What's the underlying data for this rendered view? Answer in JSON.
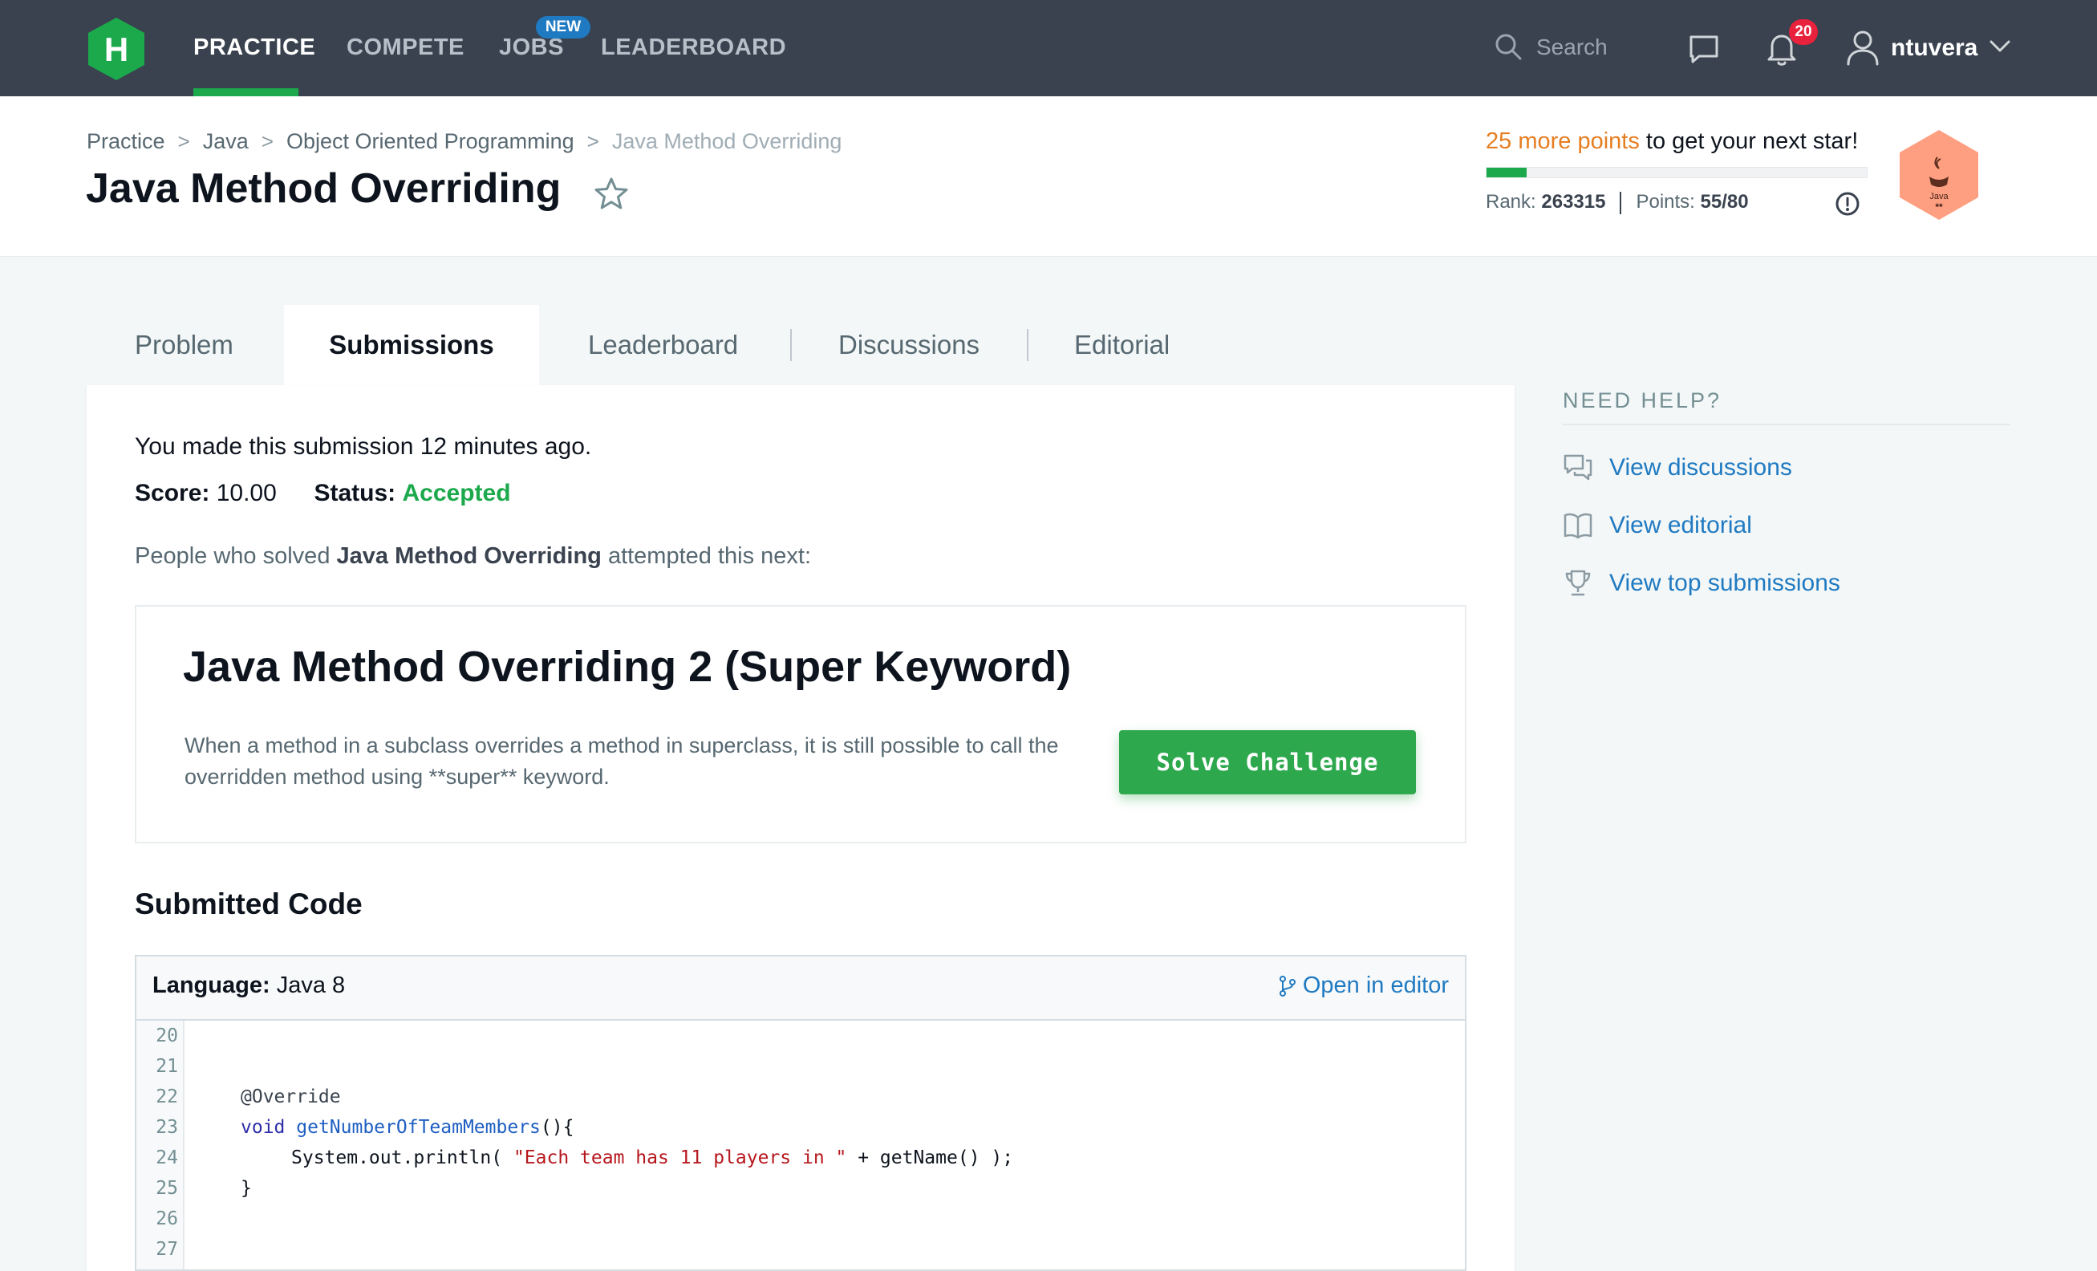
{
  "nav": {
    "logo_letter": "H",
    "items": [
      {
        "label": "PRACTICE"
      },
      {
        "label": "COMPETE"
      },
      {
        "label": "JOBS"
      },
      {
        "label": "LEADERBOARD"
      }
    ],
    "jobs_badge": "NEW",
    "search_placeholder": "Search",
    "notification_count": "20",
    "username": "ntuvera"
  },
  "breadcrumb": [
    "Practice",
    "Java",
    "Object Oriented Programming",
    "Java Method Overriding"
  ],
  "page_title": "Java Method Overriding",
  "progress": {
    "points_needed": "25 more points",
    "suffix": "to get your next star!",
    "fill_fraction": 0.106,
    "rank_label": "Rank:",
    "rank_value": "263315",
    "points_label": "Points:",
    "points_value": "55/80",
    "badge_text": "Java",
    "badge_stars": "**",
    "badge_color": "#ff9f81"
  },
  "tabs": [
    {
      "label": "Problem"
    },
    {
      "label": "Submissions"
    },
    {
      "label": "Leaderboard"
    },
    {
      "label": "Discussions"
    },
    {
      "label": "Editorial"
    }
  ],
  "submission": {
    "time_text": "You made this submission 12 minutes ago.",
    "score_label": "Score:",
    "score_value": "10.00",
    "status_label": "Status:",
    "status_value": "Accepted",
    "people_prefix": "People who solved",
    "people_challenge": "Java Method Overriding",
    "people_suffix": "attempted this next:"
  },
  "next_challenge": {
    "title": "Java Method Overriding 2 (Super Keyword)",
    "description": "When a method in a subclass overrides a method in superclass, it is still possible to call the overridden method using **super** keyword.",
    "button_label": "Solve Challenge"
  },
  "submitted_code": {
    "section_title": "Submitted Code",
    "language_label": "Language:",
    "language_value": "Java 8",
    "open_editor_label": "Open in editor",
    "lines": [
      {
        "no": "20"
      },
      {
        "no": "21"
      },
      {
        "no": "22"
      },
      {
        "no": "23"
      },
      {
        "no": "24"
      },
      {
        "no": "25"
      },
      {
        "no": "26"
      },
      {
        "no": "27"
      }
    ],
    "code": {
      "ann": "@Override",
      "void_kw": "void",
      "method_name": "getNumberOfTeamMembers",
      "method_tail": "(){",
      "print_prefix": "System.out.println( ",
      "print_string": "\"Each team has 11 players in \"",
      "print_suffix": " + getName() );",
      "close_brace": "}"
    }
  },
  "sidebar": {
    "title": "NEED HELP?",
    "links": [
      {
        "label": "View discussions",
        "icon": "discussions-icon"
      },
      {
        "label": "View editorial",
        "icon": "book-icon"
      },
      {
        "label": "View top submissions",
        "icon": "trophy-icon"
      }
    ]
  },
  "colors": {
    "nav_bg": "#39424e",
    "accent_green": "#1ba94c",
    "link_blue": "#1f7ac2",
    "points_orange": "#e67e22",
    "notification_red": "#e8213c"
  }
}
